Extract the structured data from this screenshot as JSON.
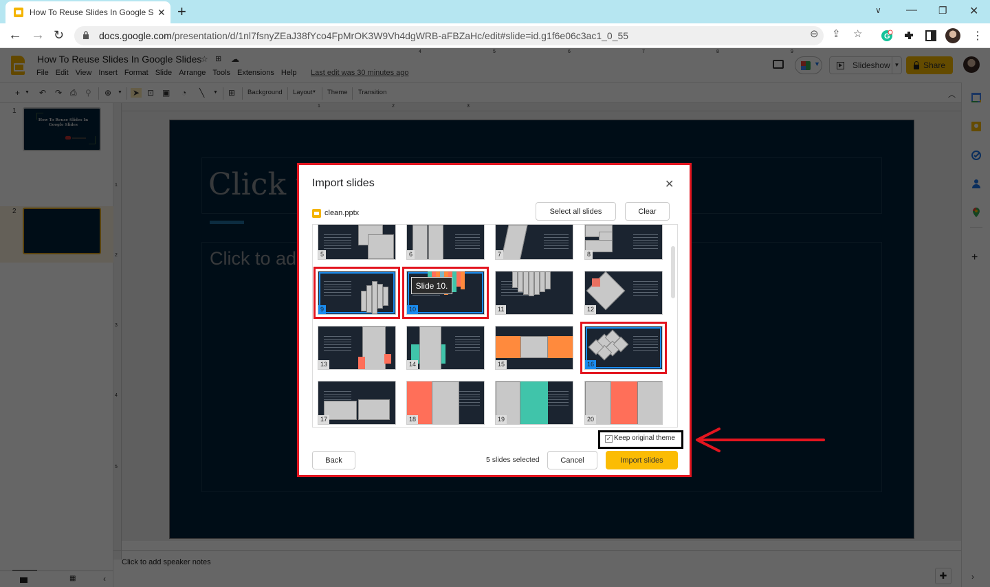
{
  "browser": {
    "tab_title": "How To Reuse Slides In Google Slides",
    "tab_title_visible": "How To Reuse Slides In Google Sl",
    "new_tab_label": "+",
    "url_host": "docs.google.com",
    "url_path": "/presentation/d/1nl7fsnyZEaJ38fYco4FpMrOK3W9Vh4dgWRB-aFBZaHc/edit#slide=id.g1f6e06c3ac1_0_55"
  },
  "docs": {
    "title": "How To Reuse Slides In Google Slides",
    "menu": [
      "File",
      "Edit",
      "View",
      "Insert",
      "Format",
      "Slide",
      "Arrange",
      "Tools",
      "Extensions",
      "Help"
    ],
    "last_edit": "Last edit was 30 minutes ago",
    "slideshow_label": "Slideshow",
    "share_label": "Share",
    "toolbar": {
      "background": "Background",
      "layout": "Layout",
      "theme": "Theme",
      "transition": "Transition"
    }
  },
  "filmstrip": {
    "slides": [
      {
        "number": "1",
        "title": "How To Reuse Slides In Google Slides"
      },
      {
        "number": "2"
      }
    ]
  },
  "ruler": {
    "h_labels": [
      "1",
      "2",
      "3",
      "4",
      "5",
      "6",
      "7",
      "8",
      "9"
    ],
    "v_labels": [
      "1",
      "2",
      "3",
      "4",
      "5"
    ]
  },
  "slide": {
    "title_placeholder": "Click t",
    "subtitle_placeholder": "Click to add"
  },
  "notes_placeholder": "Click to add speaker notes",
  "dialog": {
    "title": "Import slides",
    "file_name": "clean.pptx",
    "select_all_label": "Select all slides",
    "clear_label": "Clear",
    "tooltip": "Slide 10.",
    "thumbnails": [
      {
        "number": "5",
        "selected": false
      },
      {
        "number": "6",
        "selected": false
      },
      {
        "number": "7",
        "selected": false
      },
      {
        "number": "8",
        "selected": false
      },
      {
        "number": "9",
        "selected": true
      },
      {
        "number": "10",
        "selected": true
      },
      {
        "number": "11",
        "selected": false
      },
      {
        "number": "12",
        "selected": false
      },
      {
        "number": "13",
        "selected": false
      },
      {
        "number": "14",
        "selected": false
      },
      {
        "number": "15",
        "selected": false
      },
      {
        "number": "16",
        "selected": true
      },
      {
        "number": "17",
        "selected": false
      },
      {
        "number": "18",
        "selected": false
      },
      {
        "number": "19",
        "selected": false
      },
      {
        "number": "20",
        "selected": false
      }
    ],
    "keep_theme_label": "Keep original theme",
    "keep_theme_checked": true,
    "selected_count": "5 slides selected",
    "back_label": "Back",
    "cancel_label": "Cancel",
    "import_label": "Import slides"
  },
  "colors": {
    "accent_yellow": "#fbbc04",
    "annotation_red": "#e3151f",
    "selection_blue": "#1a8cf0",
    "slide_bg": "#02213a"
  }
}
